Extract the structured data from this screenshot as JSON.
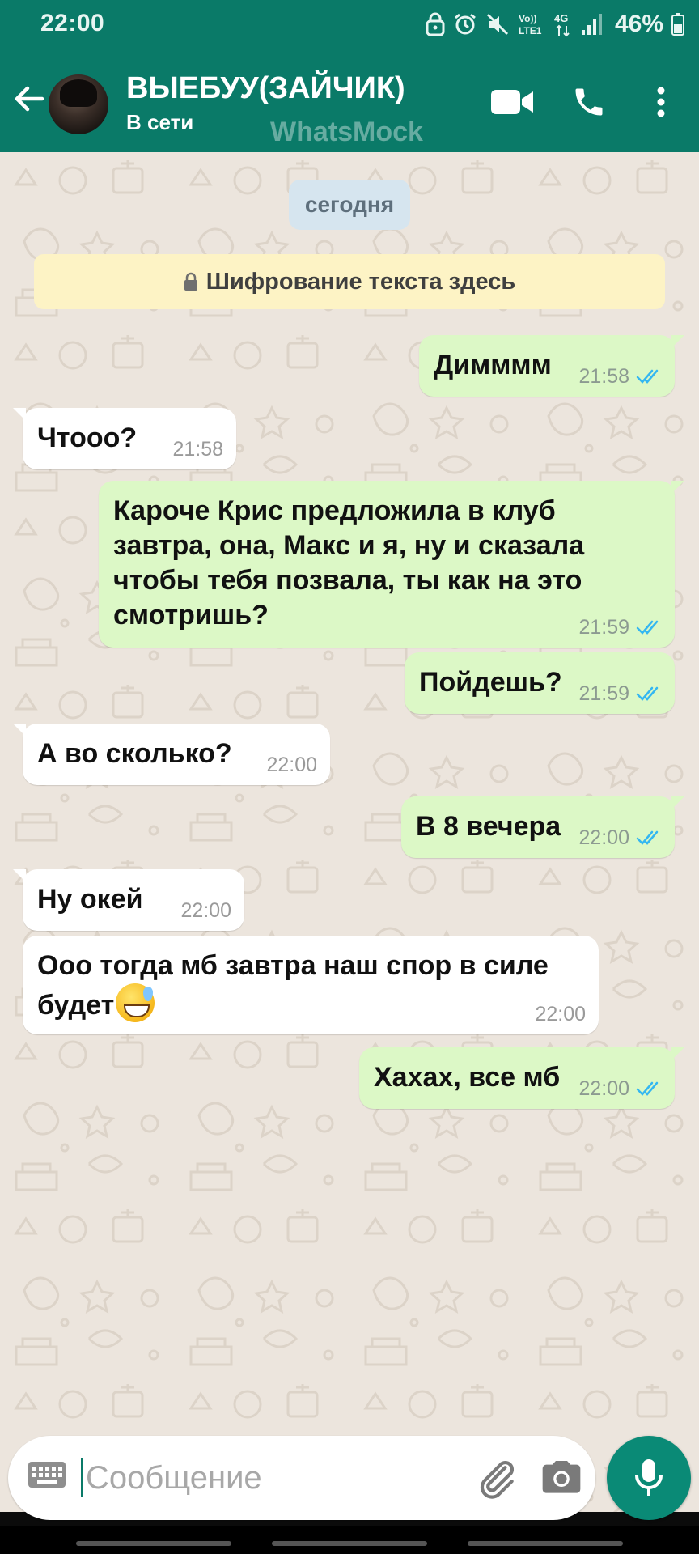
{
  "status_bar": {
    "time": "22:00",
    "battery": "46%",
    "icons": [
      "lock-icon",
      "alarm-icon",
      "mute-icon",
      "volte-lte-icon",
      "4g-icon",
      "signal-icon",
      "battery-icon"
    ],
    "network_label_top": "Vo))",
    "network_label_bottom": "LTE1",
    "data_label": "4G"
  },
  "header": {
    "contact_name": "ВЫЕБУУ(ЗАЙЧИК)",
    "status": "В сети",
    "watermark": "WhatsMock",
    "icons": [
      "back-arrow-icon",
      "video-call-icon",
      "phone-call-icon",
      "more-vert-icon"
    ]
  },
  "chat": {
    "date_label": "сегодня",
    "encryption_notice": "Шифрование текста здесь",
    "messages": [
      {
        "dir": "out",
        "text": "Димммм",
        "time": "21:58",
        "read": true
      },
      {
        "dir": "in",
        "text": "Чтооо?",
        "time": "21:58"
      },
      {
        "dir": "out",
        "lines": [
          "Кароче Крис предложила в клуб",
          "завтра, она, Макс и я, ну и сказала",
          "чтобы тебя позвала, ты как на это",
          "смотришь?"
        ],
        "time": "21:59",
        "read": true
      },
      {
        "dir": "out",
        "text": "Пойдешь?",
        "time": "21:59",
        "read": true
      },
      {
        "dir": "in",
        "text": "А во сколько?",
        "time": "22:00"
      },
      {
        "dir": "out",
        "text": "В 8 вечера",
        "time": "22:00",
        "read": true
      },
      {
        "dir": "in",
        "text": "Ну окей",
        "time": "22:00"
      },
      {
        "dir": "in",
        "lines": [
          "Ооо тогда мб завтра наш спор в силе",
          "будет"
        ],
        "emoji": "grinning-face-with-sweat-icon",
        "time": "22:00"
      },
      {
        "dir": "out",
        "text": "Хахах, все мб",
        "time": "22:00",
        "read": true
      }
    ]
  },
  "composer": {
    "placeholder": "Сообщение",
    "icons": [
      "keyboard-icon",
      "attach-icon",
      "camera-icon",
      "mic-icon"
    ]
  },
  "colors": {
    "header": "#0a7a68",
    "outgoing_bubble": "#dcf8c6",
    "incoming_bubble": "#ffffff",
    "chat_background": "#ece5dd",
    "read_ticks": "#34b7f1",
    "mic_button": "#0a8a76"
  }
}
